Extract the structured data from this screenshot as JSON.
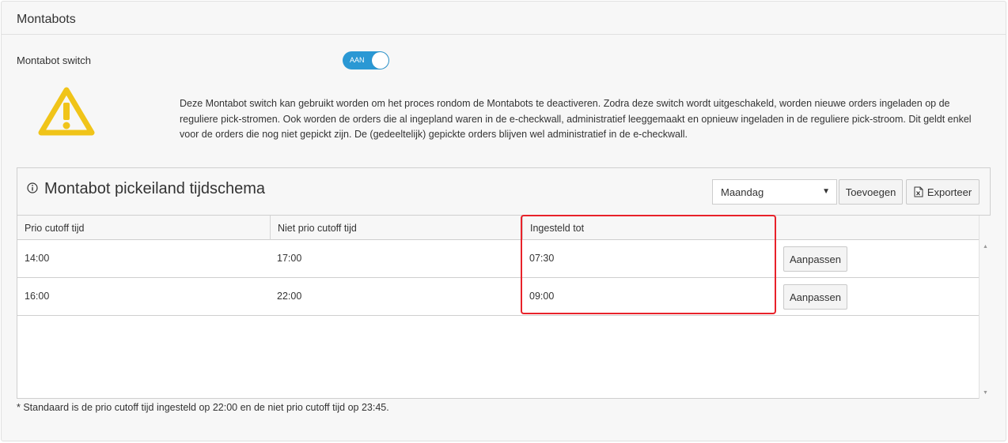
{
  "panel": {
    "title": "Montabots"
  },
  "switch": {
    "label": "Montabot switch",
    "state": "AAN"
  },
  "warning": {
    "icon": "warning-triangle-icon",
    "text": "Deze Montabot switch kan gebruikt worden om het proces rondom de Montabots te deactiveren. Zodra deze switch wordt uitgeschakeld, worden nieuwe orders ingeladen op de reguliere pick-stromen. Ook worden de orders die al ingepland waren in de e-checkwall, administratief leeggemaakt en opnieuw ingeladen in de reguliere pick-stroom. Dit geldt enkel voor de orders die nog niet gepickt zijn. De (gedeeltelijk) gepickte orders blijven wel administratief in de e-checkwall."
  },
  "schedule": {
    "title": "Montabot pickeiland tijdschema",
    "day_select": "Maandag",
    "add_label": "Toevoegen",
    "export_label": "Exporteer",
    "columns": [
      "Prio cutoff tijd",
      "Niet prio cutoff tijd",
      "Ingesteld tot"
    ],
    "rows": [
      {
        "prio": "14:00",
        "niet_prio": "17:00",
        "ingesteld": "07:30",
        "action": "Aanpassen"
      },
      {
        "prio": "16:00",
        "niet_prio": "22:00",
        "ingesteld": "09:00",
        "action": "Aanpassen"
      }
    ]
  },
  "footnote": "* Standaard is de prio cutoff tijd ingesteld op 22:00 en de niet prio cutoff tijd op 23:45.",
  "colors": {
    "accent": "#2a98d4",
    "warning": "#f0c419",
    "highlight": "#e8222a"
  }
}
